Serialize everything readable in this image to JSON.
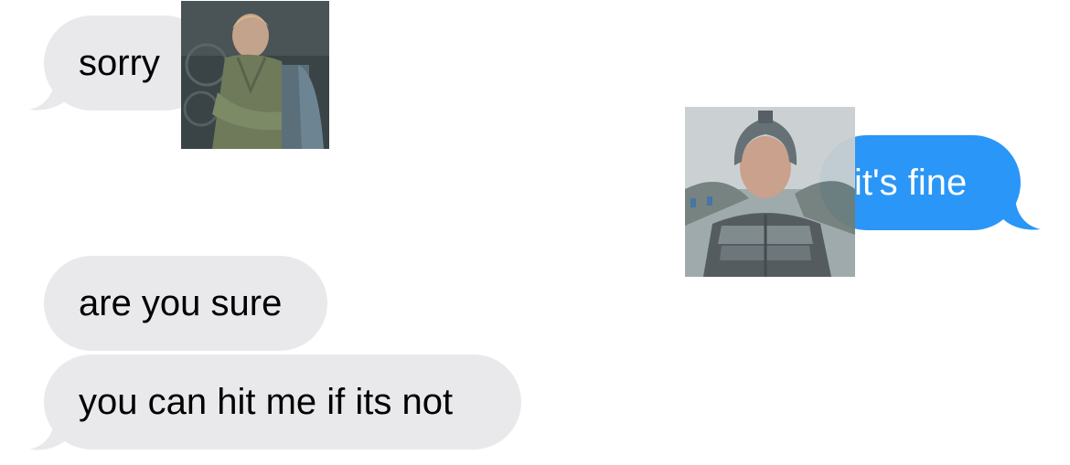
{
  "conversation": {
    "messages": [
      {
        "id": "m1",
        "direction": "incoming",
        "text": "sorry"
      },
      {
        "id": "m2",
        "direction": "outgoing",
        "text": "it's fine"
      },
      {
        "id": "m3",
        "direction": "incoming",
        "text": "are you sure"
      },
      {
        "id": "m4",
        "direction": "incoming",
        "text": "you can hit me if its not"
      }
    ],
    "stickers": [
      {
        "id": "s1",
        "icon": "person-photo-icon",
        "attached_to": "m1"
      },
      {
        "id": "s2",
        "icon": "knight-photo-icon",
        "attached_to": "m2"
      }
    ]
  },
  "colors": {
    "incoming_bubble": "#e9e9eb",
    "outgoing_bubble": "#2a96f7",
    "incoming_text": "#000000",
    "outgoing_text": "#ffffff",
    "background": "#ffffff"
  }
}
